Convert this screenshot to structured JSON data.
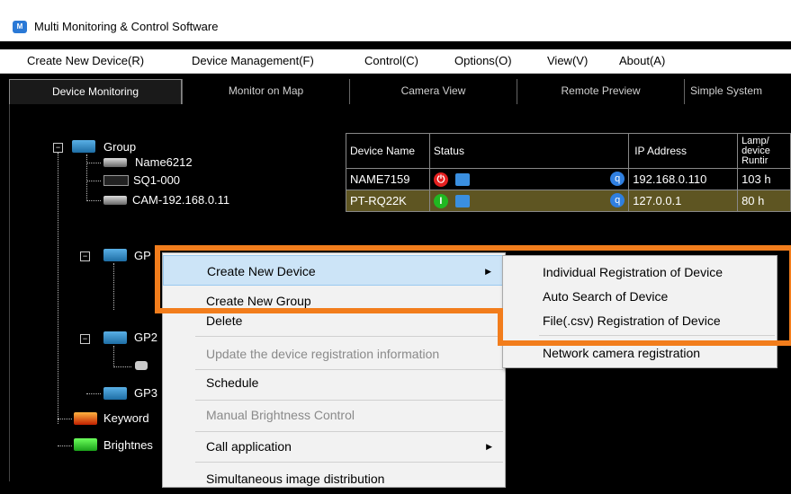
{
  "window": {
    "title": "Multi Monitoring & Control Software",
    "icon": "app-logo-icon"
  },
  "menu": [
    "Create New Device(R)",
    "Device Management(F)",
    "Control(C)",
    "Options(O)",
    "View(V)",
    "About(A)"
  ],
  "tabs": [
    "Device Monitoring",
    "Monitor on Map",
    "Camera View",
    "Remote Preview",
    "Simple System"
  ],
  "tree": {
    "group": "Group",
    "name6212": "Name6212",
    "sq1": "SQ1-000",
    "cam": "CAM-192.168.0.11",
    "gp1": "GP",
    "gp2": "GP2",
    "gp3": "GP3",
    "keyword": "Keyword",
    "brightness": "Brightnes"
  },
  "table": {
    "headers": {
      "name": "Device Name",
      "status": "Status",
      "ip": "IP Address",
      "lamp": "Lamp/ device Runtir"
    },
    "rows": [
      {
        "name": "NAME7159",
        "ip": "192.168.0.110",
        "lamp": "103 h",
        "status": "power-off"
      },
      {
        "name": "PT-RQ22K",
        "ip": "127.0.0.1",
        "lamp": "80 h",
        "status": "power-on"
      }
    ]
  },
  "context_menu": [
    "Create New Device",
    "Create New Group",
    "Delete",
    "Update the device registration information",
    "Schedule",
    "Manual Brightness Control",
    "Call application",
    "Simultaneous image distribution"
  ],
  "submenu": [
    "Individual Registration of Device",
    "Auto Search of Device",
    "File(.csv) Registration of Device",
    "Network camera registration"
  ],
  "colors": {
    "highlight_box": "#f27d1c",
    "menu_hover": "#cce4f7",
    "selected_row": "#5e5522"
  }
}
